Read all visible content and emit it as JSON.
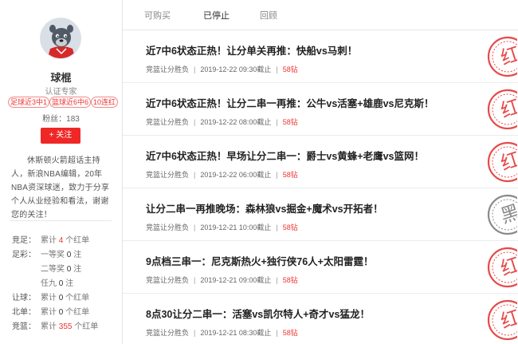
{
  "profile": {
    "name": "球棍",
    "title": "认证专家",
    "tags": [
      "足球近3中1",
      "篮球近6中6",
      "10连红"
    ],
    "fans": "粉丝：183",
    "follow_label": "+ 关注",
    "bio": "休斯顿火箭超话主持人，新浪NBA编辑，20年NBA资深球迷，致力于分享个人从业经验和看法，谢谢您的关注！"
  },
  "stats": [
    {
      "label": "竞足：",
      "prefix": "累计",
      "num": "4",
      "suffix": "个红单",
      "highlight": true
    },
    {
      "label": "足彩：",
      "prefix": "一等奖",
      "num": "0",
      "suffix": "注",
      "highlight": false
    },
    {
      "label": "",
      "prefix": "二等奖",
      "num": "0",
      "suffix": "注",
      "highlight": false
    },
    {
      "label": "",
      "prefix": "任九",
      "num": "0",
      "suffix": "注",
      "highlight": false
    },
    {
      "label": "让球：",
      "prefix": "累计",
      "num": "0",
      "suffix": "个红单",
      "highlight": false
    },
    {
      "label": "北单：",
      "prefix": "累计",
      "num": "0",
      "suffix": "个红单",
      "highlight": false
    },
    {
      "label": "竞篮：",
      "prefix": "累计",
      "num": "355",
      "suffix": "个红单",
      "highlight": true
    }
  ],
  "tabs": [
    {
      "label": "可购买",
      "active": false
    },
    {
      "label": "已停止",
      "active": true
    },
    {
      "label": "回顾",
      "active": false
    }
  ],
  "articles": [
    {
      "title": "近7中6状态正热！让分单关再推：快船vs马刺！",
      "category": "竞篮让分胜负",
      "time": "2019-12-22 09:30截止",
      "price": "58钻",
      "result": "红"
    },
    {
      "title": "近7中6状态正热！让分二串一再推：公牛vs活塞+雄鹿vs尼克斯！",
      "category": "竞篮让分胜负",
      "time": "2019-12-22 08:00截止",
      "price": "58钻",
      "result": "红"
    },
    {
      "title": "近7中6状态正热！早场让分二串一：爵士vs黄蜂+老鹰vs篮网！",
      "category": "竞篮让分胜负",
      "time": "2019-12-22 06:00截止",
      "price": "58钻",
      "result": "红"
    },
    {
      "title": "让分二串一再推晚场：森林狼vs掘金+魔术vs开拓者！",
      "category": "竞篮让分胜负",
      "time": "2019-12-21 10:00截止",
      "price": "58钻",
      "result": "黑"
    },
    {
      "title": "9点档三串一：尼克斯热火+独行侠76人+太阳雷霆！",
      "category": "竞篮让分胜负",
      "time": "2019-12-21 09:00截止",
      "price": "58钻",
      "result": "红"
    },
    {
      "title": "8点30让分二串一：活塞vs凯尔特人+奇才vs猛龙！",
      "category": "竞篮让分胜负",
      "time": "2019-12-21 08:30截止",
      "price": "58钻",
      "result": "红"
    }
  ],
  "colors": {
    "accent_red": "#f02727",
    "win_stamp": "#e64a4a",
    "lose_stamp": "#8a8a8a"
  }
}
